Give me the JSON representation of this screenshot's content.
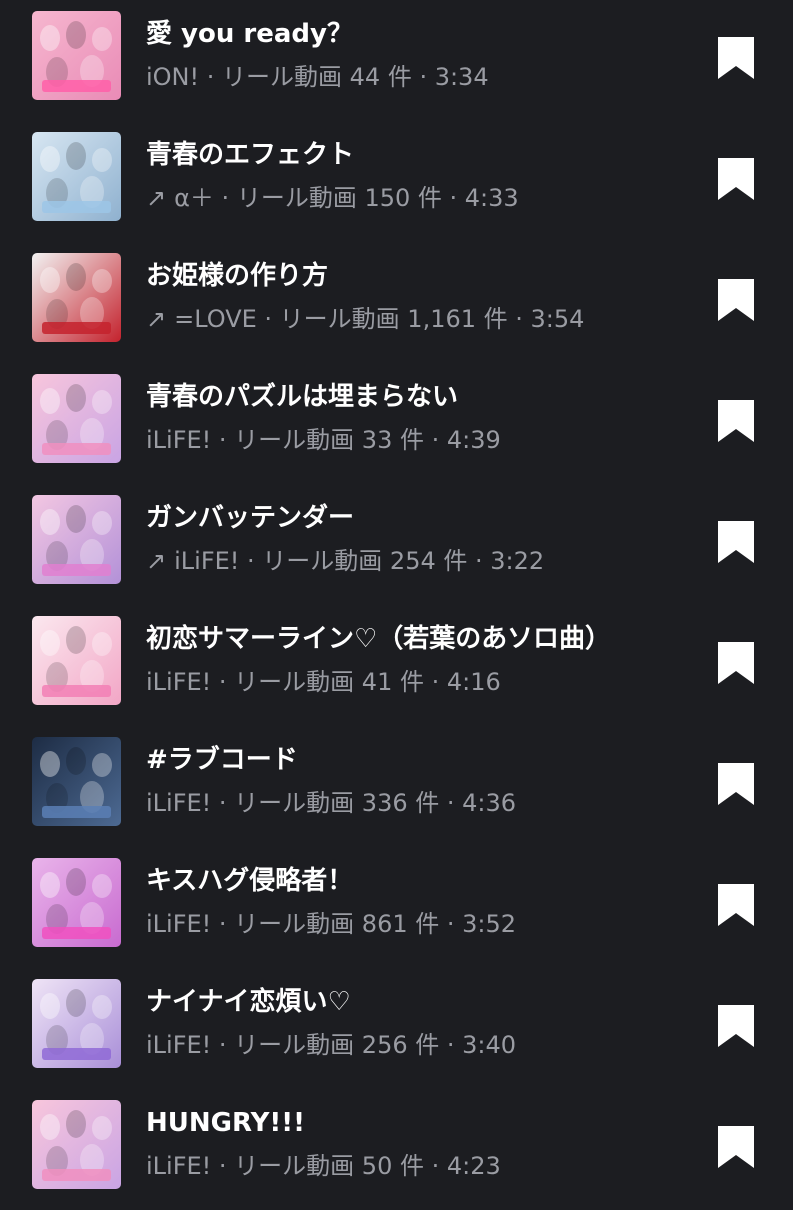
{
  "songs": [
    {
      "title": "愛 you ready？",
      "artist": "iON!",
      "arrow": "",
      "meta": "iON! · リール動画 44 件 · 3:34",
      "thumb_colors": [
        "#f6b7cf",
        "#e98bb6"
      ],
      "strip_color": "#ff5fa8",
      "thumb_icon": "album-art"
    },
    {
      "title": "青春のエフェクト",
      "artist": "α＋",
      "arrow": "↗",
      "meta": "α＋ · リール動画 150 件 · 4:33",
      "thumb_colors": [
        "#d7e6f2",
        "#8fb1cf"
      ],
      "strip_color": "#9cc6e6",
      "thumb_icon": "album-art"
    },
    {
      "title": "お姫様の作り方",
      "artist": "=LOVE",
      "arrow": "↗",
      "meta": "=LOVE · リール動画 1,161 件 · 3:54",
      "thumb_colors": [
        "#f2f2f2",
        "#c4222d"
      ],
      "strip_color": "#c4222d",
      "thumb_icon": "album-art"
    },
    {
      "title": "青春のパズルは埋まらない",
      "artist": "iLiFE!",
      "arrow": "",
      "meta": "iLiFE! · リール動画 33 件 · 4:39",
      "thumb_colors": [
        "#f8c6dc",
        "#c9a4e4"
      ],
      "strip_color": "#f08fc0",
      "thumb_icon": "album-art"
    },
    {
      "title": "ガンバッテンダー",
      "artist": "iLiFE!",
      "arrow": "↗",
      "meta": "iLiFE! · リール動画 254 件 · 3:22",
      "thumb_colors": [
        "#f3c7e2",
        "#b391d8"
      ],
      "strip_color": "#e07fd0",
      "thumb_icon": "album-art"
    },
    {
      "title": "初恋サマーライン♡（若葉のあソロ曲）",
      "artist": "iLiFE!",
      "arrow": "",
      "meta": "iLiFE! · リール動画 41 件 · 4:16",
      "thumb_colors": [
        "#fbe8ef",
        "#f2a6c6"
      ],
      "strip_color": "#f27fb5",
      "thumb_icon": "album-art"
    },
    {
      "title": "#ラブコード",
      "artist": "iLiFE!",
      "arrow": "",
      "meta": "iLiFE! · リール動画 336 件 · 4:36",
      "thumb_colors": [
        "#1d2c44",
        "#4d6a93"
      ],
      "strip_color": "#5b7fb5",
      "thumb_icon": "album-art"
    },
    {
      "title": "キスハグ侵略者！",
      "artist": "iLiFE!",
      "arrow": "",
      "meta": "iLiFE! · リール動画 861 件 · 3:52",
      "thumb_colors": [
        "#e9b4ea",
        "#c86bd0"
      ],
      "strip_color": "#f050c0",
      "thumb_icon": "album-art"
    },
    {
      "title": "ナイナイ恋煩い♡",
      "artist": "iLiFE!",
      "arrow": "",
      "meta": "iLiFE! · リール動画 256 件 · 3:40",
      "thumb_colors": [
        "#efe4f6",
        "#a98fd8"
      ],
      "strip_color": "#8f6ad6",
      "thumb_icon": "album-art"
    },
    {
      "title": "HUNGRY!!!",
      "artist": "iLiFE!",
      "arrow": "",
      "meta": "iLiFE! · リール動画 50 件 · 4:23",
      "thumb_colors": [
        "#f8c6dc",
        "#c9a4e4"
      ],
      "strip_color": "#f08fc0",
      "thumb_icon": "album-art"
    }
  ],
  "bookmark_icon": "bookmark-icon",
  "colors": {
    "background": "#1c1d21",
    "title": "#ffffff",
    "meta": "#9a9ca3",
    "bookmark": "#ffffff"
  }
}
